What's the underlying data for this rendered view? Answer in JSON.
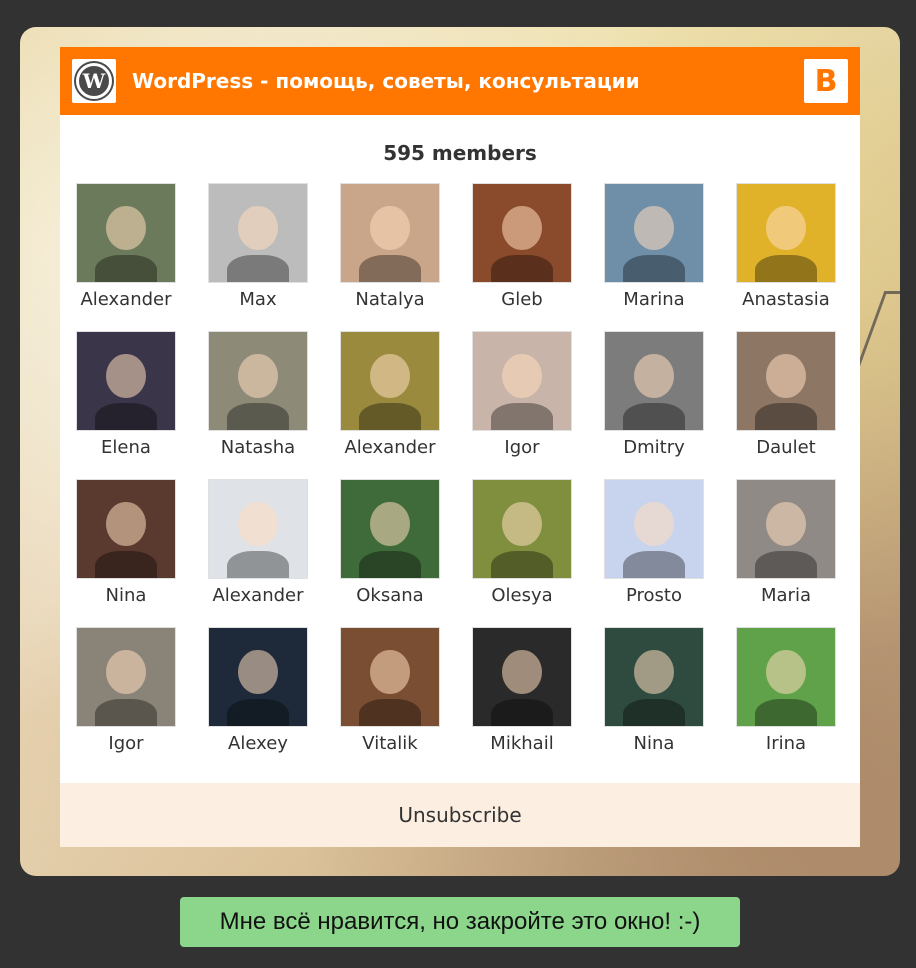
{
  "header": {
    "title": "WordPress - помощь, советы, консультации",
    "logo_icon": "wordpress-logo-icon",
    "blogger_icon": "blogger-icon",
    "blogger_letter": "B",
    "wp_letter": "W",
    "accent_color": "#ff7700"
  },
  "members_count_label": "595 members",
  "members": [
    {
      "name": "Alexander",
      "color": "#6b7a5a"
    },
    {
      "name": "Max",
      "color": "#bcbcbc"
    },
    {
      "name": "Natalya",
      "color": "#c9a58a"
    },
    {
      "name": "Gleb",
      "color": "#8a4a2c"
    },
    {
      "name": "Marina",
      "color": "#6f8fa8"
    },
    {
      "name": "Anastasia",
      "color": "#e0b22a"
    },
    {
      "name": "Elena",
      "color": "#3a3548"
    },
    {
      "name": "Natasha",
      "color": "#8d8a78"
    },
    {
      "name": "Alexander",
      "color": "#9a8a3e"
    },
    {
      "name": "Igor",
      "color": "#c8b4a8"
    },
    {
      "name": "Dmitry",
      "color": "#7c7c7c"
    },
    {
      "name": "Daulet",
      "color": "#8d7664"
    },
    {
      "name": "Nina",
      "color": "#5a3a2e"
    },
    {
      "name": "Alexander",
      "color": "#dfe3e8"
    },
    {
      "name": "Oksana",
      "color": "#3f6b3a"
    },
    {
      "name": "Olesya",
      "color": "#7f8f3e"
    },
    {
      "name": "Prosto",
      "color": "#c8d4ee"
    },
    {
      "name": "Maria",
      "color": "#8f8a86"
    },
    {
      "name": "Igor",
      "color": "#8a8478"
    },
    {
      "name": "Alexey",
      "color": "#1e2a3a"
    },
    {
      "name": "Vitalik",
      "color": "#7a4e32"
    },
    {
      "name": "Mikhail",
      "color": "#2a2a2a"
    },
    {
      "name": "Nina",
      "color": "#2f4a3e"
    },
    {
      "name": "Irina",
      "color": "#5fa24a"
    }
  ],
  "unsubscribe_label": "Unsubscribe",
  "close_button_label": "Мне всё нравится, но закройте это окно! :-)"
}
